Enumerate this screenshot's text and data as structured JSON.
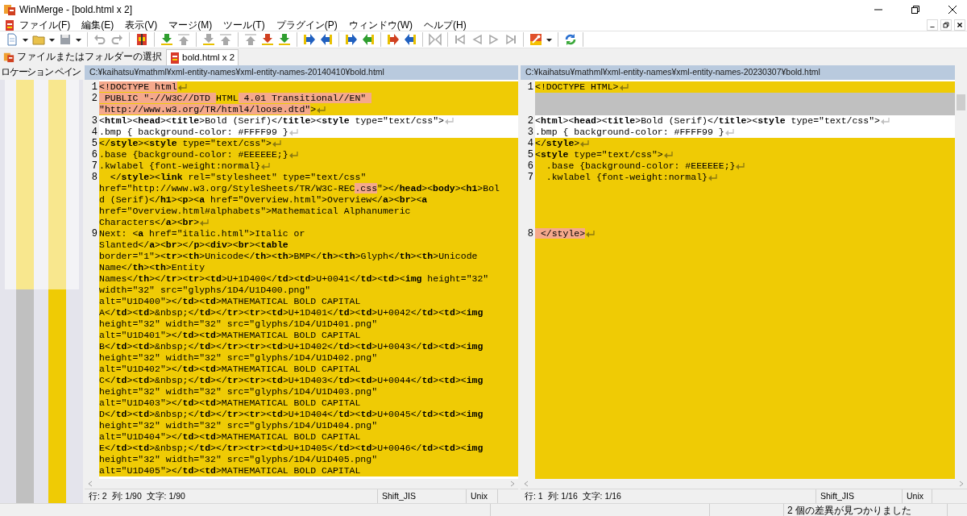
{
  "window": {
    "title": "WinMerge - [bold.html x 2]"
  },
  "menu": [
    "ファイル(F)",
    "編集(E)",
    "表示(V)",
    "マージ(M)",
    "ツール(T)",
    "プラグイン(P)",
    "ウィンドウ(W)",
    "ヘルプ(H)"
  ],
  "tabs": [
    {
      "label": "ファイルまたはフォルダーの選択",
      "selected": false
    },
    {
      "label": "bold.html x 2",
      "selected": true
    }
  ],
  "location_pane": {
    "title": "ロケーション ペイン"
  },
  "panes": [
    {
      "path": "C:¥kaihatsu¥mathml¥xml-entity-names¥xml-entity-names-20140410¥bold.html",
      "lines": [
        {
          "num": "1",
          "kind": "diff",
          "segments": [
            {
              "text": "<!DOCTYPE html",
              "changed": true
            }
          ],
          "eol": true
        },
        {
          "num": "2",
          "kind": "diff",
          "segments": [
            {
              "text": " PUBLIC \"-//W3C//DTD ",
              "changed": true
            },
            {
              "text": "HTML",
              "changed": false
            },
            {
              "text": " 4.01 Transitional//EN\" ",
              "changed": true
            }
          ]
        },
        {
          "kind": "diff",
          "segments": [
            {
              "text": "\"http://www.w3.org/TR/html4/loose.dtd\"",
              "changed": true
            },
            {
              "text": ">",
              "changed": false
            }
          ],
          "eol": true
        },
        {
          "num": "3",
          "kind": "same",
          "text": "<**html**><**head**><**title**>Bold (Serif)</**title**><**style** type=\"text/css\">",
          "eol": true
        },
        {
          "num": "4",
          "kind": "same",
          "text": ".bmp { background-color: #FFFF99 }",
          "eol": true
        },
        {
          "num": "5",
          "kind": "diff",
          "text": "</**style**><**style** type=\"text/css\">",
          "eol": true
        },
        {
          "num": "6",
          "kind": "diff",
          "text": ".base {background-color: #EEEEEE;}",
          "eol": true
        },
        {
          "num": "7",
          "kind": "diff",
          "text": ".kwlabel {font-weight:normal}",
          "eol": true
        },
        {
          "num": "8",
          "kind": "diff",
          "text": "  </**style**><**link** rel=\"stylesheet\" type=\"text/css\""
        },
        {
          "kind": "diff",
          "segments": [
            {
              "text": "href=\"http://www.w3.org/StyleSheets/TR/W3C-REC",
              "changed": false
            },
            {
              "text": ".css",
              "changed": true
            },
            {
              "text": "\"></**head**><**body**><**h1**>Bol",
              "changed": false
            }
          ]
        },
        {
          "kind": "diff",
          "text": "d (Serif)</**h1**><**p**><**a** href=\"Overview.html\">Overview</**a**><**br**><**a**"
        },
        {
          "kind": "diff",
          "text": "href=\"Overview.html#alphabets\">Mathematical Alphanumeric"
        },
        {
          "kind": "diff",
          "text": "Characters</**a**><**br**>",
          "eol": true
        },
        {
          "num": "9",
          "kind": "diff",
          "text": "Next: <**a** href=\"italic.html\">Italic or"
        },
        {
          "kind": "diff",
          "text": "Slanted</**a**><**br**></**p**><**div**><**br**><**table**"
        },
        {
          "kind": "diff",
          "text": "border=\"1\"><**tr**><**th**>Unicode</**th**><**th**>BMP</**th**><**th**>Glyph</**th**><**th**>Unicode"
        },
        {
          "kind": "diff",
          "text": "Name</**th**><**th**>Entity"
        },
        {
          "kind": "diff",
          "text": "Names</**th**></**tr**><**tr**><**td**>U+1D400</**td**><**td**>U+0041</**td**><**td**><**img** height=\"32\""
        },
        {
          "kind": "diff",
          "text": "width=\"32\" src=\"glyphs/1D4/U1D400.png\""
        },
        {
          "kind": "diff",
          "text": "alt=\"U1D400\"></**td**><**td**>MATHEMATICAL BOLD CAPITAL"
        },
        {
          "kind": "diff",
          "text": "A</**td**><**td**>&nbsp;</**td**></**tr**><**tr**><**td**>U+1D401</**td**><**td**>U+0042</**td**><**td**><**img**"
        },
        {
          "kind": "diff",
          "text": "height=\"32\" width=\"32\" src=\"glyphs/1D4/U1D401.png\""
        },
        {
          "kind": "diff",
          "text": "alt=\"U1D401\"></**td**><**td**>MATHEMATICAL BOLD CAPITAL"
        },
        {
          "kind": "diff",
          "text": "B</**td**><**td**>&nbsp;</**td**></**tr**><**tr**><**td**>U+1D402</**td**><**td**>U+0043</**td**><**td**><**img**"
        },
        {
          "kind": "diff",
          "text": "height=\"32\" width=\"32\" src=\"glyphs/1D4/U1D402.png\""
        },
        {
          "kind": "diff",
          "text": "alt=\"U1D402\"></**td**><**td**>MATHEMATICAL BOLD CAPITAL"
        },
        {
          "kind": "diff",
          "text": "C</**td**><**td**>&nbsp;</**td**></**tr**><**tr**><**td**>U+1D403</**td**><**td**>U+0044</**td**><**td**><**img**"
        },
        {
          "kind": "diff",
          "text": "height=\"32\" width=\"32\" src=\"glyphs/1D4/U1D403.png\""
        },
        {
          "kind": "diff",
          "text": "alt=\"U1D403\"></**td**><**td**>MATHEMATICAL BOLD CAPITAL"
        },
        {
          "kind": "diff",
          "text": "D</**td**><**td**>&nbsp;</**td**></**tr**><**tr**><**td**>U+1D404</**td**><**td**>U+0045</**td**><**td**><**img**"
        },
        {
          "kind": "diff",
          "text": "height=\"32\" width=\"32\" src=\"glyphs/1D4/U1D404.png\""
        },
        {
          "kind": "diff",
          "text": "alt=\"U1D404\"></**td**><**td**>MATHEMATICAL BOLD CAPITAL"
        },
        {
          "kind": "diff",
          "text": "E</**td**><**td**>&nbsp;</**td**></**tr**><**tr**><**td**>U+1D405</**td**><**td**>U+0046</**td**><**td**><**img**"
        },
        {
          "kind": "diff",
          "text": "height=\"32\" width=\"32\" src=\"glyphs/1D4/U1D405.png\""
        },
        {
          "kind": "diff",
          "text": "alt=\"U1D405\"></**td**><**td**>MATHEMATICAL BOLD CAPITAL"
        }
      ],
      "status": {
        "position": "行: 2  列: 1/90  文字: 1/90",
        "encoding": "Shift_JIS",
        "eol_style": "Unix"
      }
    },
    {
      "path": "C:¥kaihatsu¥mathml¥xml-entity-names¥xml-entity-names-20230307¥bold.html",
      "tail_highlighted": true,
      "lines": [
        {
          "num": "1",
          "kind": "diff",
          "text": "<!DOCTYPE HTML>",
          "eol": true
        },
        {
          "kind": "missing"
        },
        {
          "kind": "missing"
        },
        {
          "num": "2",
          "kind": "same",
          "text": "<**html**><**head**><**title**>Bold (Serif)</**title**><**style** type=\"text/css\">",
          "eol": true
        },
        {
          "num": "3",
          "kind": "same",
          "text": ".bmp { background-color: #FFFF99 }",
          "eol": true
        },
        {
          "num": "4",
          "kind": "diff",
          "text": "</**style**>",
          "eol": true
        },
        {
          "num": "5",
          "kind": "diff",
          "text": "<**style** type=\"text/css\">",
          "eol": true
        },
        {
          "num": "6",
          "kind": "diff",
          "text": "  .base {background-color: #EEEEEE;}",
          "eol": true
        },
        {
          "num": "7",
          "kind": "diff",
          "text": "  .kwlabel {font-weight:normal}",
          "eol": true
        },
        {
          "kind": "filler"
        },
        {
          "kind": "filler"
        },
        {
          "kind": "filler"
        },
        {
          "kind": "filler"
        },
        {
          "num": "8",
          "kind": "diff",
          "segments": [
            {
              "text": " </style>",
              "changed": true
            }
          ],
          "eol": true
        }
      ],
      "status": {
        "position": "行: 1  列: 1/16  文字: 1/16",
        "encoding": "Shift_JIS",
        "eol_style": "Unix"
      }
    }
  ],
  "status_bar": {
    "message": "2 個の差異が見つかりました"
  }
}
